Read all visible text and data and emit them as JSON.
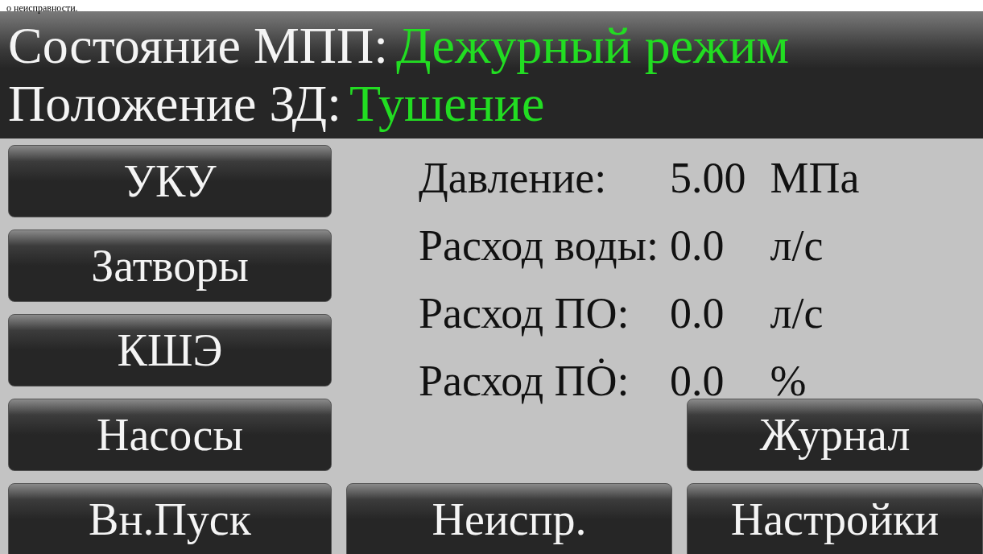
{
  "caption": "о неисправности.",
  "status": [
    {
      "label": "Состояние МПП:",
      "value": "Дежурный режим"
    },
    {
      "label": "Положение ЗД:",
      "value": "Тушение"
    }
  ],
  "side_buttons": [
    "УКУ",
    "Затворы",
    "КШЭ",
    "Насосы"
  ],
  "readings": [
    {
      "label": "Давление:",
      "value": "5.00",
      "unit": "МПа"
    },
    {
      "label": "Расход воды:",
      "value": "0.0",
      "unit": "л/с"
    },
    {
      "label": "Расход ПО:",
      "value": "0.0",
      "unit": "л/с"
    },
    {
      "label": "Расход ПȮ:",
      "value": "0.0",
      "unit": "%"
    }
  ],
  "journal_button": "Журнал",
  "bottom_buttons": [
    "Вн.Пуск",
    "Неиспр.",
    "Настройки"
  ]
}
